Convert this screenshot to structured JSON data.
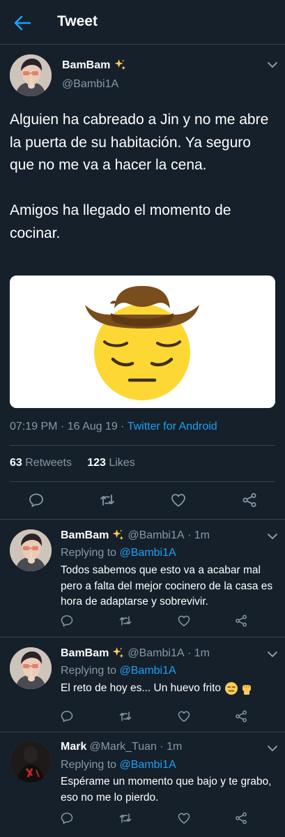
{
  "header": {
    "title": "Tweet"
  },
  "tweet": {
    "name": "BamBam",
    "handle": "@Bambi1A",
    "text": "Alguien ha cabreado a Jin y no me abre la puerta de su habitación. Ya seguro que no me va a hacer la cena.\n\nAmigos ha llegado el momento de cocinar.",
    "media": "cowboy-pensive-face-emoji",
    "time": "07:19 PM",
    "date": "16 Aug 19",
    "source": "Twitter for Android",
    "retweets": "63",
    "retweets_label": "Retweets",
    "likes": "123",
    "likes_label": "Likes"
  },
  "replies": [
    {
      "name": "BamBam",
      "handle": "@Bambi1A",
      "time": "1m",
      "replying_label": "Replying to",
      "replying_to": "@Bambi1A",
      "text": "Todos sabemos que esto va a acabar mal pero a falta del mejor cocinero de la casa es hora de adaptarse y sobrevivir."
    },
    {
      "name": "BamBam",
      "handle": "@Bambi1A",
      "time": "1m",
      "replying_label": "Replying to",
      "replying_to": "@Bambi1A",
      "text": "El reto de hoy es... Un huevo frito"
    },
    {
      "name": "Mark",
      "handle": "@Mark_Tuan",
      "time": "1m",
      "replying_label": "Replying to",
      "replying_to": "@Bambi1A",
      "text": "Espérame un momento que bajo y te grabo, eso no me lo pierdo."
    }
  ],
  "colors": {
    "background": "#15202b",
    "accent": "#1da1f2",
    "secondary_text": "#8899a6",
    "divider": "#38444d"
  }
}
